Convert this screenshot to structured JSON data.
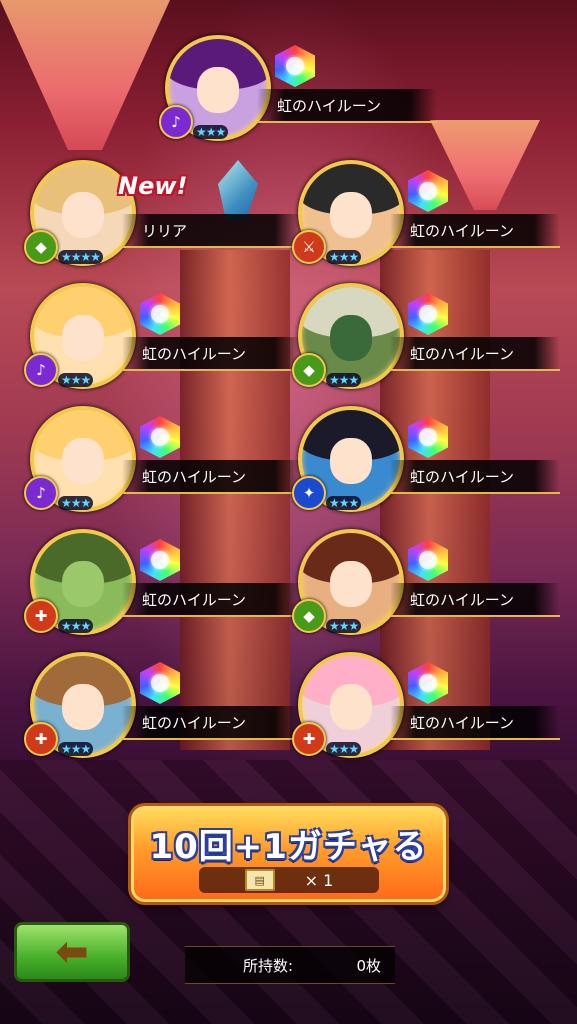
{
  "new_badge": "New!",
  "cards": [
    {
      "name": "虹のハイルーン",
      "stars": "★★★",
      "type_icon": "♪",
      "type_color": "#7a2ad0",
      "hair": "#5a1a7a",
      "has_rune": true
    },
    {
      "name": "リリア",
      "stars": "★★★★",
      "type_icon": "◆",
      "type_color": "#4a9a1a",
      "hair": "#e8c07a",
      "has_rune": false
    },
    {
      "name": "虹のハイルーン",
      "stars": "★★★",
      "type_icon": "⚔",
      "type_color": "#d03a1a",
      "hair": "#2a2a2a",
      "has_rune": true
    },
    {
      "name": "虹のハイルーン",
      "stars": "★★★",
      "type_icon": "♪",
      "type_color": "#7a2ad0",
      "hair": "#ffd070",
      "has_rune": true
    },
    {
      "name": "虹のハイルーン",
      "stars": "★★★",
      "type_icon": "◆",
      "type_color": "#4a9a1a",
      "hair": "#d8d8c0",
      "has_rune": true
    },
    {
      "name": "虹のハイルーン",
      "stars": "★★★",
      "type_icon": "♪",
      "type_color": "#7a2ad0",
      "hair": "#ffd070",
      "has_rune": true
    },
    {
      "name": "虹のハイルーン",
      "stars": "★★★",
      "type_icon": "✦",
      "type_color": "#1a4ad0",
      "hair": "#1a1a2a",
      "has_rune": true
    },
    {
      "name": "虹のハイルーン",
      "stars": "★★★",
      "type_icon": "✚",
      "type_color": "#d03a1a",
      "hair": "#4a6a2a",
      "has_rune": true
    },
    {
      "name": "虹のハイルーン",
      "stars": "★★★",
      "type_icon": "◆",
      "type_color": "#4a9a1a",
      "hair": "#6a2a1a",
      "has_rune": true
    },
    {
      "name": "虹のハイルーン",
      "stars": "★★★",
      "type_icon": "✚",
      "type_color": "#d03a1a",
      "hair": "#a06a3a",
      "has_rune": true
    },
    {
      "name": "虹のハイルーン",
      "stars": "★★★",
      "type_icon": "✚",
      "type_color": "#d03a1a",
      "hair": "#ffb0c8",
      "has_rune": true
    }
  ],
  "gacha_button": {
    "label": "10回+1ガチャる",
    "ticket_count": "× 1"
  },
  "owned": {
    "label": "所持数:",
    "value": "0枚"
  },
  "back_button": {
    "icon": "left-arrow-icon"
  }
}
